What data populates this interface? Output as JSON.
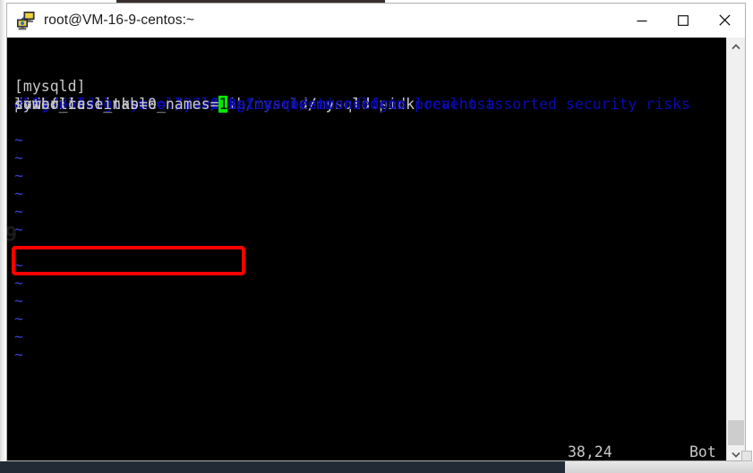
{
  "window": {
    "title": "root@VM-16-9-centos:~",
    "icon": "putty-network-computers-icon",
    "controls": {
      "minimize_label": "Minimize",
      "maximize_label": "Maximize",
      "close_label": "Close"
    }
  },
  "terminal": {
    "editor": "vim",
    "file_lines": [
      {
        "segments": [
          {
            "text": "[mysqld]",
            "style": "text"
          }
        ]
      },
      {
        "segments": [
          {
            "text": "pid-file        = /var/run/mysqld/mysqld.pid",
            "style": "text"
          }
        ]
      },
      {
        "segments": [
          {
            "text": "socket          = /var/run/mysqld/mysqld.sock",
            "style": "text"
          }
        ]
      },
      {
        "segments": [
          {
            "text": "datadir         = /var/lib/mysql",
            "style": "text"
          }
        ]
      },
      {
        "segments": [
          {
            "text": "#log-error      = /var/log/mysql/error.log",
            "style": "comment"
          }
        ]
      },
      {
        "segments": [
          {
            "text": "# By default we only accept connections from localhost",
            "style": "comment"
          }
        ]
      },
      {
        "segments": [
          {
            "text": "#bind-address   = 127.0.0.1",
            "style": "comment"
          }
        ]
      },
      {
        "segments": [
          {
            "text": "# Disabling symbolic-links is recommended to prevent assorted security risks",
            "style": "comment"
          }
        ]
      },
      {
        "segments": [
          {
            "text": "symbolic-links=0",
            "style": "text"
          }
        ]
      },
      {
        "segments": [
          {
            "text": "lower_case_table_names=",
            "style": "text"
          },
          {
            "text": "1",
            "style": "cursor"
          }
        ]
      }
    ],
    "empty_line_marker": "~",
    "empty_line_count": 13,
    "stray_glyph": "9",
    "status": {
      "position": "38,24",
      "relative": "Bot"
    }
  },
  "annotation": {
    "highlight_box_color": "#ff0000",
    "highlight_target": "lower_case_table_names=1"
  },
  "scrollbar": {
    "up_arrow": "chevron-up-icon",
    "down_arrow": "chevron-down-icon"
  },
  "colors": {
    "terminal_bg": "#000000",
    "terminal_fg": "#c8c8c8",
    "comment": "#0a0ab4",
    "tilde": "#3a3ad0",
    "cursor_bg": "#00e800",
    "annotation": "#ff0000",
    "titlebar_bg": "#ffffff",
    "taskbar_bg": "#222a35"
  }
}
